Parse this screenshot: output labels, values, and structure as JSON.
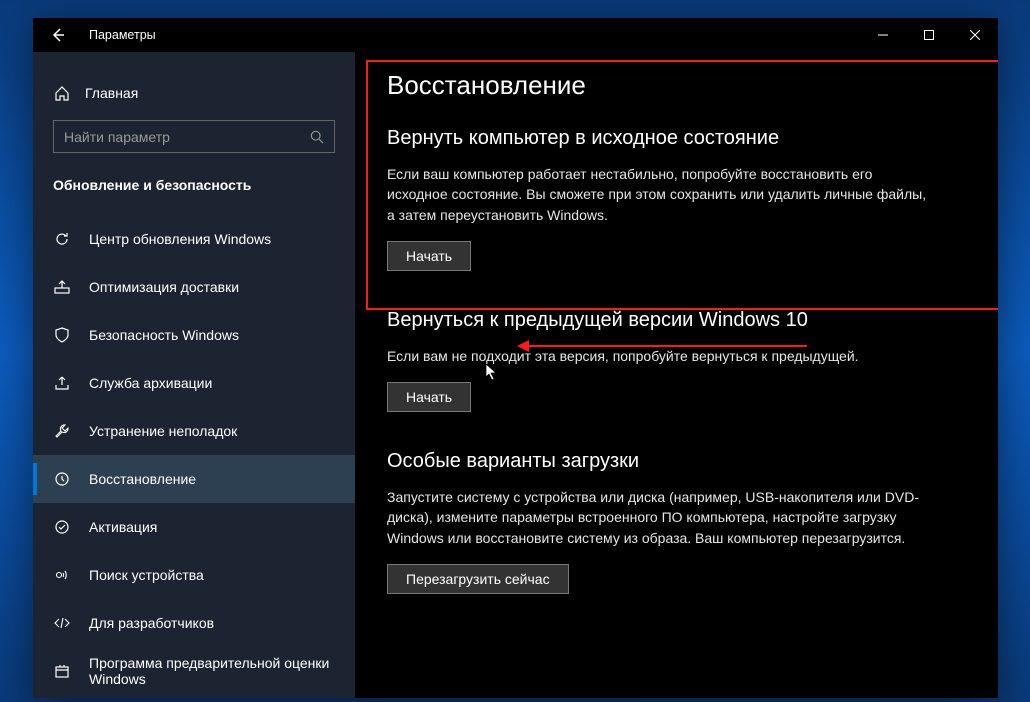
{
  "window": {
    "title": "Параметры"
  },
  "sidebar": {
    "home_label": "Главная",
    "search_placeholder": "Найти параметр",
    "category_label": "Обновление и безопасность",
    "items": [
      {
        "label": "Центр обновления Windows",
        "icon": "sync"
      },
      {
        "label": "Оптимизация доставки",
        "icon": "delivery"
      },
      {
        "label": "Безопасность Windows",
        "icon": "shield"
      },
      {
        "label": "Служба архивации",
        "icon": "backup"
      },
      {
        "label": "Устранение неполадок",
        "icon": "troubleshoot"
      },
      {
        "label": "Восстановление",
        "icon": "recovery",
        "active": true
      },
      {
        "label": "Активация",
        "icon": "activation"
      },
      {
        "label": "Поиск устройства",
        "icon": "find-device"
      },
      {
        "label": "Для разработчиков",
        "icon": "developer"
      },
      {
        "label": "Программа предварительной оценки Windows",
        "icon": "insider"
      }
    ]
  },
  "main": {
    "page_title": "Восстановление",
    "sections": [
      {
        "title": "Вернуть компьютер в исходное состояние",
        "desc": "Если ваш компьютер работает нестабильно, попробуйте восстановить его исходное состояние. Вы сможете при этом сохранить или удалить личные файлы, а затем переустановить Windows.",
        "button": "Начать"
      },
      {
        "title": "Вернуться к предыдущей версии Windows 10",
        "desc": "Если вам не подходит эта версия, попробуйте вернуться к предыдущей.",
        "button": "Начать"
      },
      {
        "title": "Особые варианты загрузки",
        "desc": "Запустите систему с устройства или диска (например, USB-накопителя или DVD-диска), измените параметры встроенного ПО компьютера, настройте загрузку Windows или восстановите систему из образа. Ваш компьютер перезагрузится.",
        "button": "Перезагрузить сейчас"
      }
    ]
  }
}
